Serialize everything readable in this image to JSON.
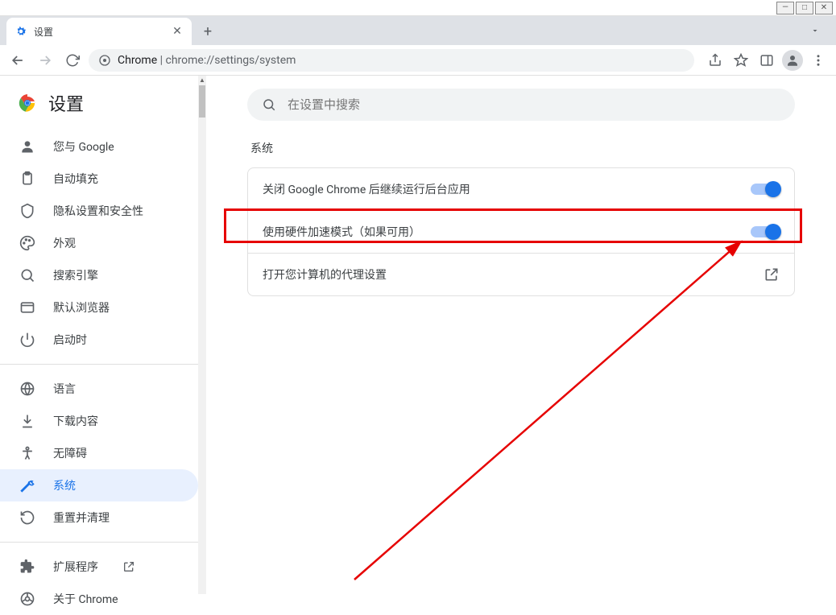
{
  "os_buttons": {
    "minimize": "—",
    "maximize": "□",
    "close": "✕"
  },
  "tab": {
    "title": "设置"
  },
  "omnibox": {
    "prefix": "Chrome",
    "url": "chrome://settings/system"
  },
  "brand": {
    "title": "设置"
  },
  "sidebar": {
    "items": [
      {
        "id": "you-and-google",
        "label": "您与 Google"
      },
      {
        "id": "autofill",
        "label": "自动填充"
      },
      {
        "id": "privacy",
        "label": "隐私设置和安全性"
      },
      {
        "id": "appearance",
        "label": "外观"
      },
      {
        "id": "search-engine",
        "label": "搜索引擎"
      },
      {
        "id": "default-browser",
        "label": "默认浏览器"
      },
      {
        "id": "startup",
        "label": "启动时"
      }
    ],
    "items2": [
      {
        "id": "languages",
        "label": "语言"
      },
      {
        "id": "downloads",
        "label": "下载内容"
      },
      {
        "id": "accessibility",
        "label": "无障碍"
      },
      {
        "id": "system",
        "label": "系统"
      },
      {
        "id": "reset",
        "label": "重置并清理"
      }
    ],
    "items3": [
      {
        "id": "extensions",
        "label": "扩展程序"
      },
      {
        "id": "about",
        "label": "关于 Chrome"
      }
    ]
  },
  "search": {
    "placeholder": "在设置中搜索"
  },
  "section": {
    "title": "系统"
  },
  "rows": {
    "bg": "关闭 Google Chrome 后继续运行后台应用",
    "hw": "使用硬件加速模式（如果可用）",
    "proxy": "打开您计算机的代理设置"
  }
}
